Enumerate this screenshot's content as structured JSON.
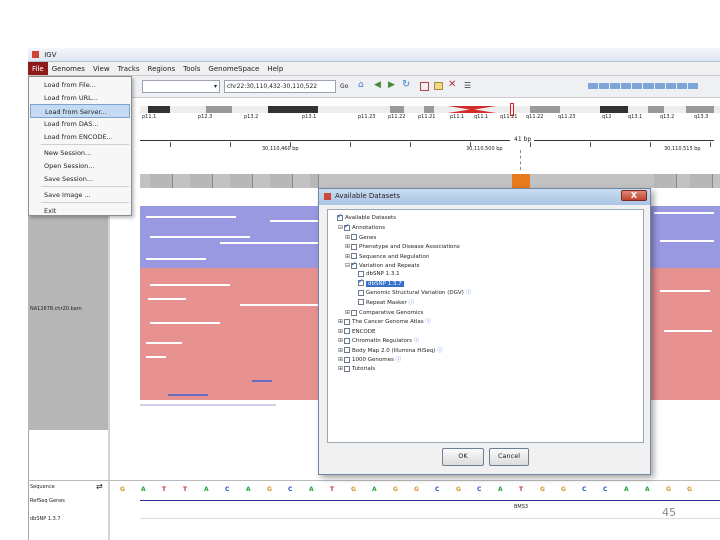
{
  "window": {
    "title": "IGV"
  },
  "menubar": {
    "items": [
      "File",
      "Genomes",
      "View",
      "Tracks",
      "Regions",
      "Tools",
      "GenomeSpace",
      "Help"
    ]
  },
  "toolbar": {
    "locus": "chr22:30,110,432-30,110,522",
    "go_label": "Go",
    "chromosome": "chr22"
  },
  "file_menu": {
    "items": [
      "Load from File...",
      "Load from URL...",
      "Load from Server...",
      "Load from DAS...",
      "Load from ENCODE...",
      "New Session...",
      "Open Session...",
      "Save Session...",
      "Save Image ...",
      "Exit"
    ],
    "highlighted": "Load from Server..."
  },
  "ideogram": {
    "bands": [
      "p11.1",
      "p12.3",
      "p13.2",
      "p13.1",
      "p11.23",
      "p11.22",
      "p11.21",
      "p11.1",
      "q11.1",
      "q11.21",
      "q11.22",
      "q11.23",
      "q12",
      "q13.1",
      "q13.2",
      "q13.3"
    ]
  },
  "ruler": {
    "span": "41 bp",
    "ticks": [
      "30,110,460 bp",
      "30,110,500 bp",
      "30,110,515 bp"
    ]
  },
  "tracks": {
    "sample_name": "NA12878.chr20.bam",
    "bottom": [
      "Sequence",
      "RefSeq Genes",
      "dbSNP 1.3.7"
    ],
    "gene_label": "BMS3"
  },
  "sequence": [
    "G",
    "A",
    "T",
    "T",
    "A",
    "C",
    "A",
    "G",
    "C",
    "A",
    "T",
    "G",
    "A",
    "G",
    "G",
    "C",
    "G",
    "C",
    "A",
    "T",
    "G",
    "G",
    "C",
    "C",
    "A",
    "A",
    "G",
    "G"
  ],
  "dialog": {
    "title": "Available Datasets",
    "close_label": "X",
    "tree": [
      {
        "label": "Available Datasets",
        "checked": true,
        "expander": "",
        "depth": 0
      },
      {
        "label": "Annotations",
        "checked": true,
        "expander": "⊟",
        "depth": 1
      },
      {
        "label": "Genes",
        "checked": false,
        "expander": "⊞",
        "depth": 2
      },
      {
        "label": "Phenotype and Disease Associations",
        "checked": false,
        "expander": "⊞",
        "depth": 2
      },
      {
        "label": "Sequence and Regulation",
        "checked": false,
        "expander": "⊞",
        "depth": 2
      },
      {
        "label": "Variation and Repeats",
        "checked": true,
        "expander": "⊟",
        "depth": 2
      },
      {
        "label": "dbSNP 1.3.1",
        "checked": false,
        "expander": "",
        "depth": 3
      },
      {
        "label": "dbSNP 1.3.7",
        "checked": true,
        "expander": "",
        "depth": 3,
        "selected": true
      },
      {
        "label": "Genomic Structural Variation (DGV)",
        "checked": false,
        "expander": "",
        "depth": 3,
        "info": true
      },
      {
        "label": "Repeat Masker",
        "checked": false,
        "expander": "",
        "depth": 3,
        "info": true
      },
      {
        "label": "Comparative Genomics",
        "checked": false,
        "expander": "⊞",
        "depth": 2
      },
      {
        "label": "The Cancer Genome Atlas",
        "checked": false,
        "expander": "⊞",
        "depth": 1,
        "info": true
      },
      {
        "label": "ENCODE",
        "checked": false,
        "expander": "⊞",
        "depth": 1
      },
      {
        "label": "Chromatin Regulators",
        "checked": false,
        "expander": "⊞",
        "depth": 1,
        "info": true
      },
      {
        "label": "Body Map 2.0 (Illumina HiSeq)",
        "checked": false,
        "expander": "⊞",
        "depth": 1,
        "info": true
      },
      {
        "label": "1000 Genomes",
        "checked": false,
        "expander": "⊞",
        "depth": 1,
        "info": true
      },
      {
        "label": "Tutorials",
        "checked": false,
        "expander": "⊞",
        "depth": 1
      }
    ],
    "ok_label": "OK",
    "cancel_label": "Cancel"
  },
  "slide": {
    "page_number": "45"
  },
  "colors": {
    "read_forward": "#e79191",
    "read_reverse": "#9999e2",
    "menu_accent": "#8f1a1a"
  }
}
